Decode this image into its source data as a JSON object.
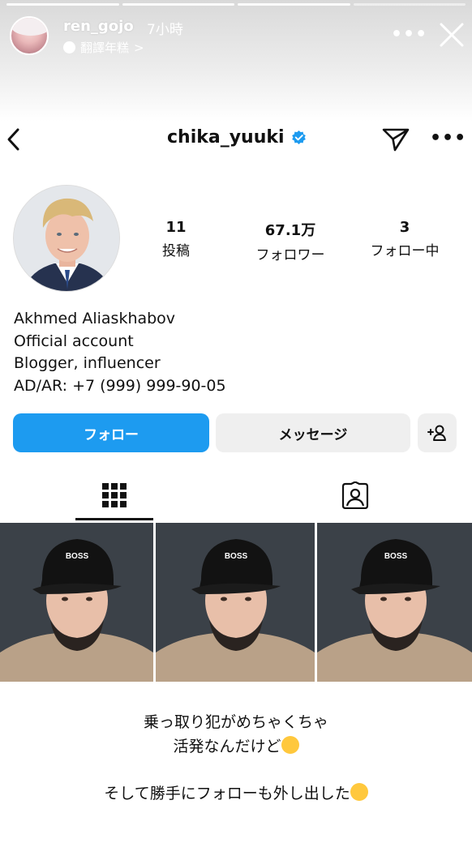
{
  "story": {
    "username": "ren_gojo",
    "time": "7小時",
    "translate_label": "翻譯年糕",
    "translate_chevron": ">"
  },
  "profile": {
    "username": "chika_yuuki",
    "stats": [
      {
        "value": "11",
        "label": "投稿"
      },
      {
        "value": "67.1万",
        "label": "フォロワー"
      },
      {
        "value": "3",
        "label": "フォロー中"
      }
    ],
    "bio_lines": [
      "Akhmed Aliaskhabov",
      "Official account",
      "Blogger, influencer",
      "AD/AR: +7 (999) 999-90-05"
    ]
  },
  "buttons": {
    "follow": "フォロー",
    "message": "メッセージ"
  },
  "posts": [
    {
      "cap_text": "BOSS"
    },
    {
      "cap_text": "BOSS"
    },
    {
      "cap_text": "BOSS"
    }
  ],
  "caption": {
    "line1": "乗っ取り犯がめちゃくちゃ",
    "line2": "活発なんだけど",
    "line3": "そして勝手にフォローも外し出した"
  },
  "colors": {
    "accent": "#1d9bf0",
    "secondary_button": "#efefef"
  },
  "icons": [
    "back-icon",
    "verified-badge-icon",
    "send-icon",
    "more-icon",
    "close-icon",
    "grid-icon",
    "tagged-icon",
    "add-person-icon",
    "globe-icon"
  ]
}
